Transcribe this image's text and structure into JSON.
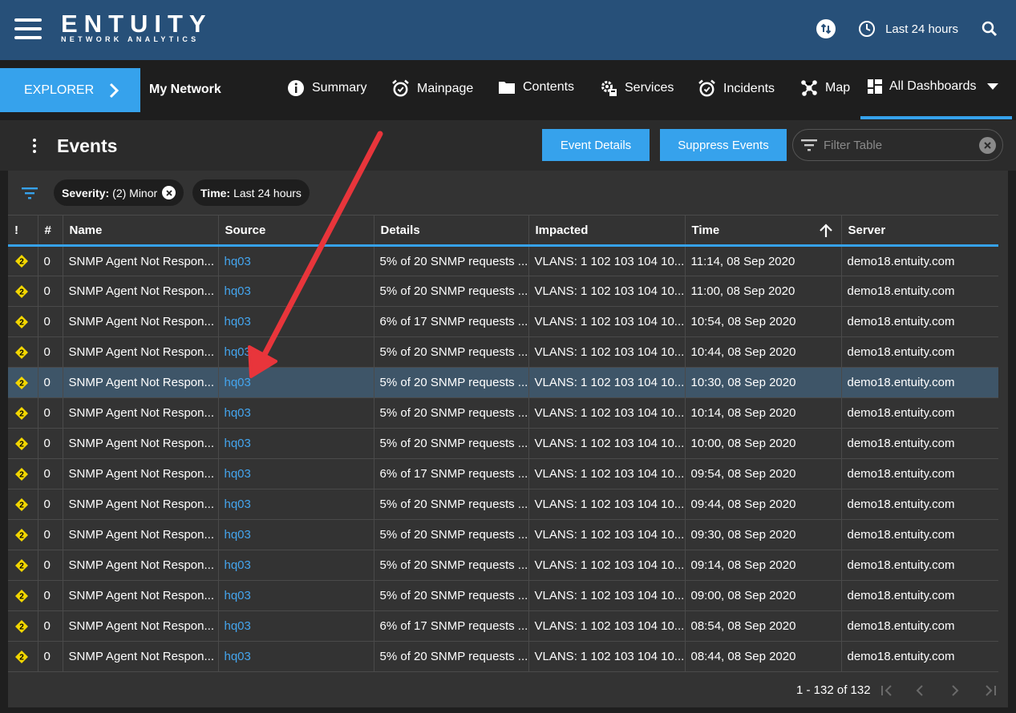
{
  "topbar": {
    "logo_main": "ENTUITY",
    "logo_sub": "NETWORK ANALYTICS",
    "time_range": "Last 24 hours"
  },
  "navbar": {
    "explorer_label": "EXPLORER",
    "context": "My Network",
    "items": [
      {
        "label": "Summary",
        "icon": "info-icon"
      },
      {
        "label": "Mainpage",
        "icon": "alarm-clock-icon"
      },
      {
        "label": "Contents",
        "icon": "folder-icon"
      },
      {
        "label": "Services",
        "icon": "gear-icon"
      },
      {
        "label": "Incidents",
        "icon": "alarm-clock-icon"
      },
      {
        "label": "Map",
        "icon": "network-icon"
      },
      {
        "label": "All Dashboards",
        "icon": "dashboard-icon"
      }
    ]
  },
  "events": {
    "title": "Events",
    "event_details_btn": "Event Details",
    "suppress_events_btn": "Suppress Events",
    "filter_placeholder": "Filter Table"
  },
  "chips": {
    "severity_key": "Severity:",
    "severity_val": "(2) Minor",
    "time_key": "Time:",
    "time_val": "Last 24 hours"
  },
  "table": {
    "columns": [
      "!",
      "#",
      "Name",
      "Source",
      "Details",
      "Impacted",
      "Time",
      "Server"
    ],
    "rows": [
      {
        "num": "0",
        "name": "SNMP Agent Not Respon...",
        "source": "hq03",
        "details": "5% of 20 SNMP requests ...",
        "impacted": "VLANS: 1 102 103 104 10...",
        "time": "11:14, 08 Sep 2020",
        "server": "demo18.entuity.com"
      },
      {
        "num": "0",
        "name": "SNMP Agent Not Respon...",
        "source": "hq03",
        "details": "5% of 20 SNMP requests ...",
        "impacted": "VLANS: 1 102 103 104 10...",
        "time": "11:00, 08 Sep 2020",
        "server": "demo18.entuity.com"
      },
      {
        "num": "0",
        "name": "SNMP Agent Not Respon...",
        "source": "hq03",
        "details": "6% of 17 SNMP requests ...",
        "impacted": "VLANS: 1 102 103 104 10...",
        "time": "10:54, 08 Sep 2020",
        "server": "demo18.entuity.com"
      },
      {
        "num": "0",
        "name": "SNMP Agent Not Respon...",
        "source": "hq03",
        "details": "5% of 20 SNMP requests ...",
        "impacted": "VLANS: 1 102 103 104 10...",
        "time": "10:44, 08 Sep 2020",
        "server": "demo18.entuity.com"
      },
      {
        "num": "0",
        "name": "SNMP Agent Not Respon...",
        "source": "hq03",
        "details": "5% of 20 SNMP requests ...",
        "impacted": "VLANS: 1 102 103 104 10...",
        "time": "10:30, 08 Sep 2020",
        "server": "demo18.entuity.com"
      },
      {
        "num": "0",
        "name": "SNMP Agent Not Respon...",
        "source": "hq03",
        "details": "5% of 20 SNMP requests ...",
        "impacted": "VLANS: 1 102 103 104 10...",
        "time": "10:14, 08 Sep 2020",
        "server": "demo18.entuity.com"
      },
      {
        "num": "0",
        "name": "SNMP Agent Not Respon...",
        "source": "hq03",
        "details": "5% of 20 SNMP requests ...",
        "impacted": "VLANS: 1 102 103 104 10...",
        "time": "10:00, 08 Sep 2020",
        "server": "demo18.entuity.com"
      },
      {
        "num": "0",
        "name": "SNMP Agent Not Respon...",
        "source": "hq03",
        "details": "6% of 17 SNMP requests ...",
        "impacted": "VLANS: 1 102 103 104 10...",
        "time": "09:54, 08 Sep 2020",
        "server": "demo18.entuity.com"
      },
      {
        "num": "0",
        "name": "SNMP Agent Not Respon...",
        "source": "hq03",
        "details": "5% of 20 SNMP requests ...",
        "impacted": "VLANS: 1 102 103 104 10...",
        "time": "09:44, 08 Sep 2020",
        "server": "demo18.entuity.com"
      },
      {
        "num": "0",
        "name": "SNMP Agent Not Respon...",
        "source": "hq03",
        "details": "5% of 20 SNMP requests ...",
        "impacted": "VLANS: 1 102 103 104 10...",
        "time": "09:30, 08 Sep 2020",
        "server": "demo18.entuity.com"
      },
      {
        "num": "0",
        "name": "SNMP Agent Not Respon...",
        "source": "hq03",
        "details": "5% of 20 SNMP requests ...",
        "impacted": "VLANS: 1 102 103 104 10...",
        "time": "09:14, 08 Sep 2020",
        "server": "demo18.entuity.com"
      },
      {
        "num": "0",
        "name": "SNMP Agent Not Respon...",
        "source": "hq03",
        "details": "5% of 20 SNMP requests ...",
        "impacted": "VLANS: 1 102 103 104 10...",
        "time": "09:00, 08 Sep 2020",
        "server": "demo18.entuity.com"
      },
      {
        "num": "0",
        "name": "SNMP Agent Not Respon...",
        "source": "hq03",
        "details": "6% of 17 SNMP requests ...",
        "impacted": "VLANS: 1 102 103 104 10...",
        "time": "08:54, 08 Sep 2020",
        "server": "demo18.entuity.com"
      },
      {
        "num": "0",
        "name": "SNMP Agent Not Respon...",
        "source": "hq03",
        "details": "5% of 20 SNMP requests ...",
        "impacted": "VLANS: 1 102 103 104 10...",
        "time": "08:44, 08 Sep 2020",
        "server": "demo18.entuity.com"
      }
    ],
    "selected_row": 4
  },
  "pager": {
    "range_text": "1 - 132 of 132"
  },
  "colors": {
    "topbar": "#275079",
    "accent": "#36a2ec",
    "link": "#44a5ee",
    "severity_minor": "#f2d600",
    "selected_row": "#3e5568",
    "annotation_arrow": "#e8353b"
  }
}
